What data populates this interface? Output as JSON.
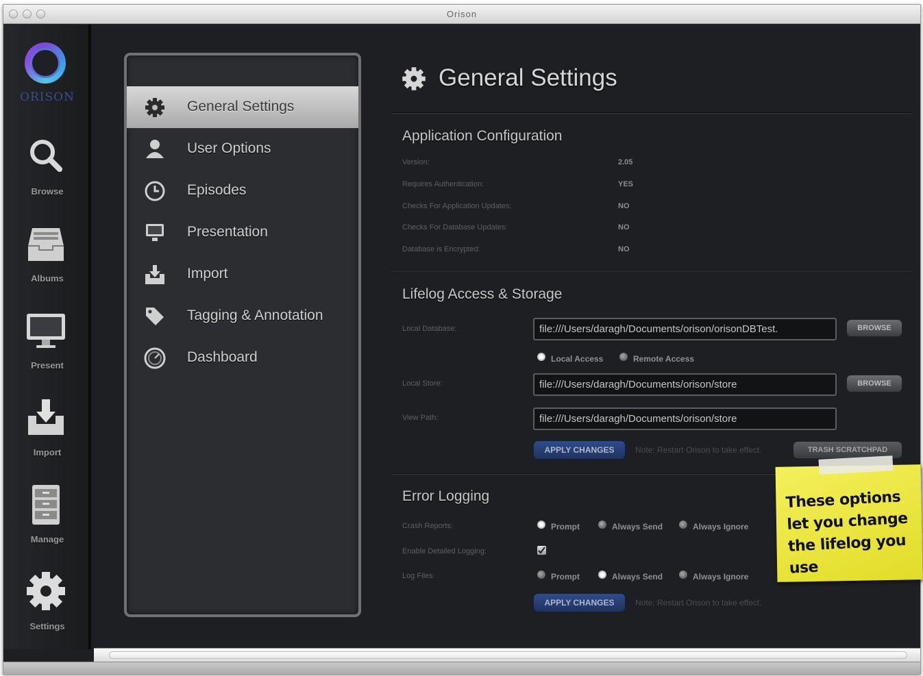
{
  "window": {
    "title": "Orison"
  },
  "brand": {
    "logo_text": "ORISON"
  },
  "sidebar": {
    "items": [
      {
        "label": "Browse",
        "icon": "search-icon"
      },
      {
        "label": "Albums",
        "icon": "inbox-tray-icon"
      },
      {
        "label": "Present",
        "icon": "monitor-icon"
      },
      {
        "label": "Import",
        "icon": "import-icon"
      },
      {
        "label": "Manage",
        "icon": "cabinet-icon"
      },
      {
        "label": "Settings",
        "icon": "gear-icon"
      }
    ]
  },
  "settings_menu": {
    "items": [
      {
        "label": "General Settings",
        "icon": "gear-icon",
        "active": true
      },
      {
        "label": "User Options",
        "icon": "user-icon"
      },
      {
        "label": "Episodes",
        "icon": "clock-icon"
      },
      {
        "label": "Presentation",
        "icon": "monitor-icon"
      },
      {
        "label": "Import",
        "icon": "import-icon"
      },
      {
        "label": "Tagging & Annotation",
        "icon": "tag-icon"
      },
      {
        "label": "Dashboard",
        "icon": "dashboard-gauge-icon"
      }
    ]
  },
  "main": {
    "title": "General Settings",
    "app_config": {
      "title": "Application Configuration",
      "rows": [
        {
          "label": "Version:",
          "value": "2.05"
        },
        {
          "label": "Requires Authentication:",
          "value": "YES"
        },
        {
          "label": "Checks For Application Updates:",
          "value": "NO"
        },
        {
          "label": "Checks For Database Updates:",
          "value": "NO"
        },
        {
          "label": "Database is Encrypted:",
          "value": "NO"
        }
      ]
    },
    "lifelog": {
      "title": "Lifelog Access & Storage",
      "local_database_label": "Local Database:",
      "local_database_value": "file:///Users/daragh/Documents/orison/orisonDBTest.",
      "browse_label": "BROWSE",
      "access_local_label": "Local Access",
      "access_remote_label": "Remote Access",
      "local_store_label": "Local Store:",
      "local_store_value": "file:///Users/daragh/Documents/orison/store",
      "view_path_label": "View Path:",
      "view_path_value": "file:///Users/daragh/Documents/orison/store",
      "apply_label": "APPLY CHANGES",
      "note": "Note: Restart Orison to take effect.",
      "trash_label": "TRASH SCRATCHPAD"
    },
    "error_logging": {
      "title": "Error Logging",
      "crash_label": "Crash Reports:",
      "detailed_label": "Enable Detailed Logging:",
      "logfiles_label": "Log Files:",
      "opt_prompt": "Prompt",
      "opt_send": "Always Send",
      "opt_ignore": "Always Ignore",
      "apply_label": "APPLY CHANGES",
      "note": "Note: Restart Orison to take effect."
    }
  },
  "sticky_note": {
    "text": "These options let you change the lifelog you use"
  },
  "colors": {
    "background": "#1d1f22",
    "apply_button": "#2f4b8a",
    "sticky": "#f0ec4a"
  }
}
